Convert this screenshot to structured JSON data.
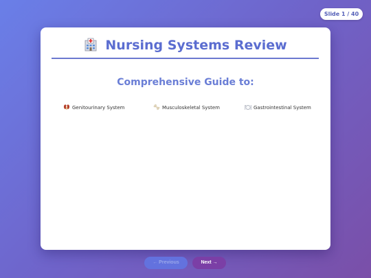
{
  "slide_counter": "Slide 1 / 40",
  "card": {
    "title_icon": "hospital-icon",
    "title": "Nursing Systems Review",
    "subtitle": "Comprehensive Guide to:",
    "topics": [
      {
        "icon": "kidney-icon",
        "label": "Genitourinary System"
      },
      {
        "icon": "bone-icon",
        "label": "Musculoskeletal System"
      },
      {
        "icon": "plate-icon",
        "label": "Gastrointestinal System"
      }
    ]
  },
  "nav": {
    "previous_label": "← Previous",
    "next_label": "Next →"
  },
  "colors": {
    "background_start": "#6a7fe8",
    "background_end": "#7a4fa8",
    "title": "#5b6dd0",
    "subtitle": "#6a7ed6",
    "previous_button": "#6372de",
    "next_button": "#7b3fa6"
  }
}
